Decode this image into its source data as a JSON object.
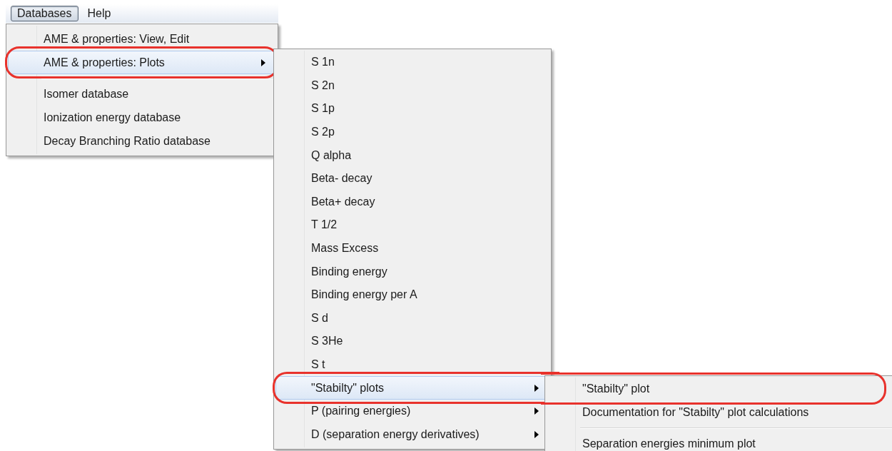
{
  "menu_bar": [
    {
      "label": "Databases",
      "selected": true
    },
    {
      "label": "Help",
      "selected": false
    }
  ],
  "menus": [
    {
      "items": [
        {
          "kind": "item",
          "label": "AME & properties: View, Edit",
          "selected": false,
          "has_submenu": false,
          "circled": false
        },
        {
          "kind": "item",
          "label": "AME & properties: Plots",
          "selected": true,
          "has_submenu": true,
          "circled": true
        },
        {
          "kind": "separator"
        },
        {
          "kind": "item",
          "label": "Isomer database",
          "selected": false,
          "has_submenu": false,
          "circled": false
        },
        {
          "kind": "item",
          "label": "Ionization energy database",
          "selected": false,
          "has_submenu": false,
          "circled": false
        },
        {
          "kind": "item",
          "label": "Decay Branching Ratio database",
          "selected": false,
          "has_submenu": false,
          "circled": false
        }
      ]
    },
    {
      "items": [
        {
          "kind": "item",
          "label": "S 1n",
          "selected": false,
          "has_submenu": false,
          "circled": false
        },
        {
          "kind": "item",
          "label": "S 2n",
          "selected": false,
          "has_submenu": false,
          "circled": false
        },
        {
          "kind": "item",
          "label": "S 1p",
          "selected": false,
          "has_submenu": false,
          "circled": false
        },
        {
          "kind": "item",
          "label": "S 2p",
          "selected": false,
          "has_submenu": false,
          "circled": false
        },
        {
          "kind": "item",
          "label": "Q alpha",
          "selected": false,
          "has_submenu": false,
          "circled": false
        },
        {
          "kind": "item",
          "label": "Beta- decay",
          "selected": false,
          "has_submenu": false,
          "circled": false
        },
        {
          "kind": "item",
          "label": "Beta+ decay",
          "selected": false,
          "has_submenu": false,
          "circled": false
        },
        {
          "kind": "item",
          "label": "T 1/2",
          "selected": false,
          "has_submenu": false,
          "circled": false
        },
        {
          "kind": "item",
          "label": "Mass Excess",
          "selected": false,
          "has_submenu": false,
          "circled": false
        },
        {
          "kind": "item",
          "label": "Binding energy",
          "selected": false,
          "has_submenu": false,
          "circled": false
        },
        {
          "kind": "item",
          "label": "Binding energy per A",
          "selected": false,
          "has_submenu": false,
          "circled": false
        },
        {
          "kind": "item",
          "label": "S d",
          "selected": false,
          "has_submenu": false,
          "circled": false
        },
        {
          "kind": "item",
          "label": "S 3He",
          "selected": false,
          "has_submenu": false,
          "circled": false
        },
        {
          "kind": "item",
          "label": "S t",
          "selected": false,
          "has_submenu": false,
          "circled": false
        },
        {
          "kind": "item",
          "label": "\"Stabilty\" plots",
          "selected": true,
          "has_submenu": true,
          "circled": true
        },
        {
          "kind": "item",
          "label": "P (pairing energies)",
          "selected": false,
          "has_submenu": true,
          "circled": false
        },
        {
          "kind": "item",
          "label": "D (separation energy derivatives)",
          "selected": false,
          "has_submenu": true,
          "circled": false
        }
      ]
    },
    {
      "items": [
        {
          "kind": "item",
          "label": "\"Stabilty\" plot",
          "selected": false,
          "has_submenu": false,
          "circled": true
        },
        {
          "kind": "item",
          "label": "Documentation for \"Stabilty\" plot calculations",
          "selected": false,
          "has_submenu": false,
          "circled": false
        },
        {
          "kind": "separator"
        },
        {
          "kind": "item",
          "label": "Separation energies minimum plot",
          "selected": false,
          "has_submenu": false,
          "circled": false
        }
      ]
    }
  ]
}
